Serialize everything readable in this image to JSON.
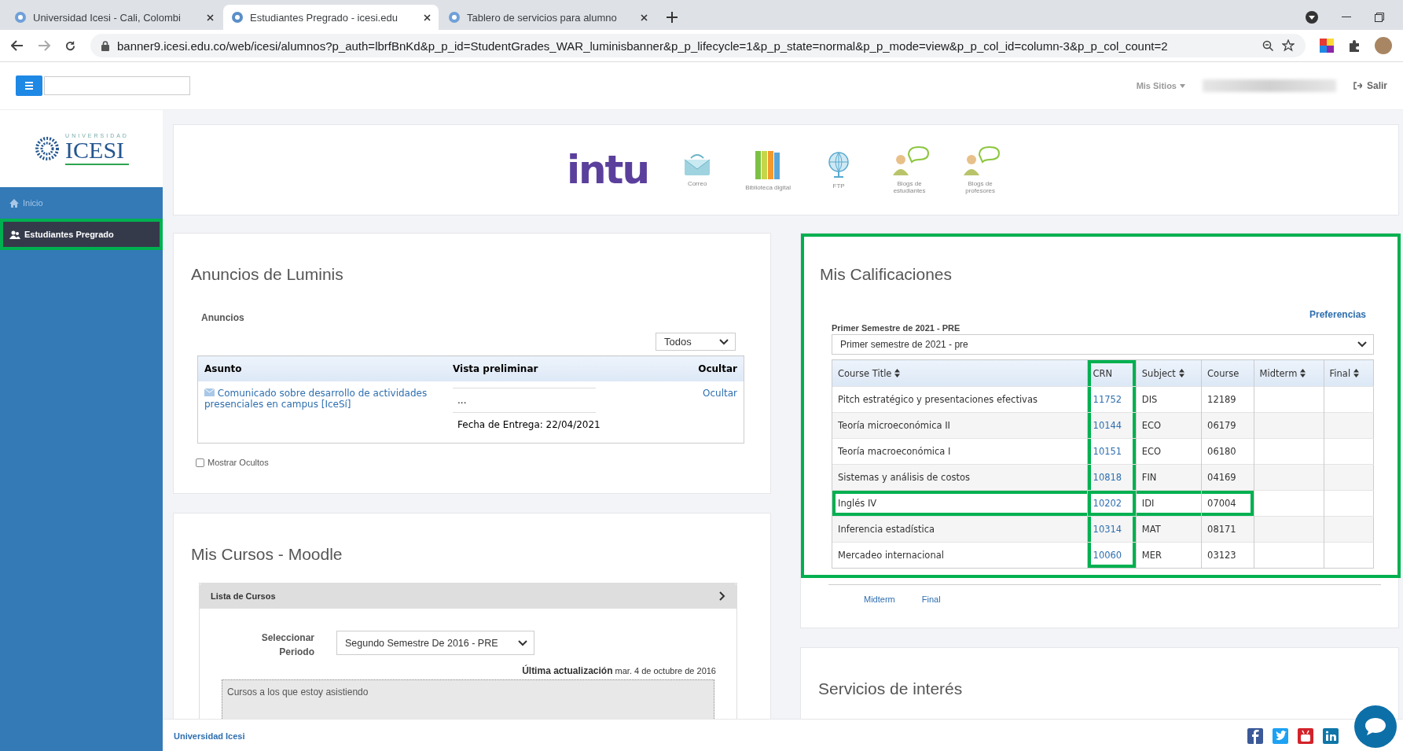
{
  "browser": {
    "tabs": [
      {
        "title": "Universidad Icesi - Cali, Colombi",
        "selected": false
      },
      {
        "title": "Estudiantes Pregrado - icesi.edu",
        "selected": true
      },
      {
        "title": "Tablero de servicios para alumno",
        "selected": false
      }
    ],
    "url": "banner9.icesi.edu.co/web/icesi/alumnos?p_auth=lbrfBnKd&p_p_id=StudentGrades_WAR_luminisbanner&p_p_lifecycle=1&p_p_state=normal&p_p_mode=view&p_p_col_id=column-3&p_p_col_count=2"
  },
  "topbar": {
    "my_sites": "Mis Sitios",
    "logout": "Salir"
  },
  "sidebar": {
    "logo_small": "UNIVERSIDAD",
    "logo_big": "ICESI",
    "items": [
      {
        "label": "Inicio",
        "kind": "home",
        "selected": false,
        "highlighted": false
      },
      {
        "label": "Estudiantes Pregrado",
        "kind": "students",
        "selected": true,
        "highlighted": true
      }
    ]
  },
  "header": {
    "logo": "intu",
    "links": [
      {
        "label": "Correo",
        "kind": "mail"
      },
      {
        "label": "Biblioteca digital",
        "kind": "books"
      },
      {
        "label": "FTP",
        "kind": "globe"
      },
      {
        "label": "Blogs de estudiantes",
        "kind": "blog"
      },
      {
        "label": "Blogs de profesores",
        "kind": "blog"
      }
    ]
  },
  "announcements": {
    "title": "Anuncios de Luminis",
    "subtitle": "Anuncios",
    "filter": "Todos",
    "columns": [
      "Asunto",
      "Vista preliminar",
      "Ocultar"
    ],
    "rows": [
      {
        "subject": "Comunicado sobre desarrollo de actividades presenciales en campus [IceSí]",
        "preview": "...",
        "date": "Fecha de Entrega: 22/04/2021",
        "action": "Ocultar"
      }
    ],
    "show_hidden": {
      "label": "Mostrar Ocultos",
      "checked": false
    }
  },
  "moodle": {
    "title": "Mis Cursos - Moodle",
    "bar": "Lista de Cursos",
    "period_label": "Seleccionar Periodo",
    "period_value": "Segundo Semestre De 2016 - PRE",
    "updated_label": "Última actualización",
    "updated_value": "mar. 4 de octubre de 2016",
    "list_heading": "Cursos a los que estoy asistiendo"
  },
  "grades": {
    "title": "Mis Calificaciones",
    "highlighted": true,
    "preferences": "Preferencias",
    "term_label": "Primer Semestre de 2021 - PRE",
    "term_select": "Primer semestre de 2021 - pre",
    "columns": [
      {
        "label": "Course Title",
        "sortable": true,
        "highlighted": false
      },
      {
        "label": "CRN",
        "sortable": false,
        "highlighted": true
      },
      {
        "label": "Subject",
        "sortable": true,
        "highlighted": false
      },
      {
        "label": "Course",
        "sortable": false,
        "highlighted": false
      },
      {
        "label": "Midterm",
        "sortable": true,
        "highlighted": false
      },
      {
        "label": "Final",
        "sortable": true,
        "highlighted": false
      }
    ],
    "rows": [
      {
        "course_title": "Pitch estratégico y presentaciones efectivas",
        "crn": "11752",
        "subject": "DIS",
        "course": "12189",
        "highlighted": false
      },
      {
        "course_title": "Teoría microeconómica II",
        "crn": "10144",
        "subject": "ECO",
        "course": "06179",
        "highlighted": false
      },
      {
        "course_title": "Teoría macroeconómica I",
        "crn": "10151",
        "subject": "ECO",
        "course": "06180",
        "highlighted": false
      },
      {
        "course_title": "Sistemas y análisis de costos",
        "crn": "10818",
        "subject": "FIN",
        "course": "04169",
        "highlighted": false
      },
      {
        "course_title": "Inglés IV",
        "crn": "10202",
        "subject": "IDI",
        "course": "07004",
        "highlighted": true
      },
      {
        "course_title": "Inferencia estadística",
        "crn": "10314",
        "subject": "MAT",
        "course": "08171",
        "highlighted": false
      },
      {
        "course_title": "Mercadeo internacional",
        "crn": "10060",
        "subject": "MER",
        "course": "03123",
        "highlighted": false
      }
    ],
    "footer_links": [
      "Midterm",
      "Final"
    ]
  },
  "services": {
    "title": "Servicios de interés"
  },
  "footer": {
    "text": "Universidad Icesi",
    "social": [
      {
        "kind": "facebook"
      },
      {
        "kind": "twitter"
      },
      {
        "kind": "youtube"
      },
      {
        "kind": "linkedin"
      }
    ]
  }
}
